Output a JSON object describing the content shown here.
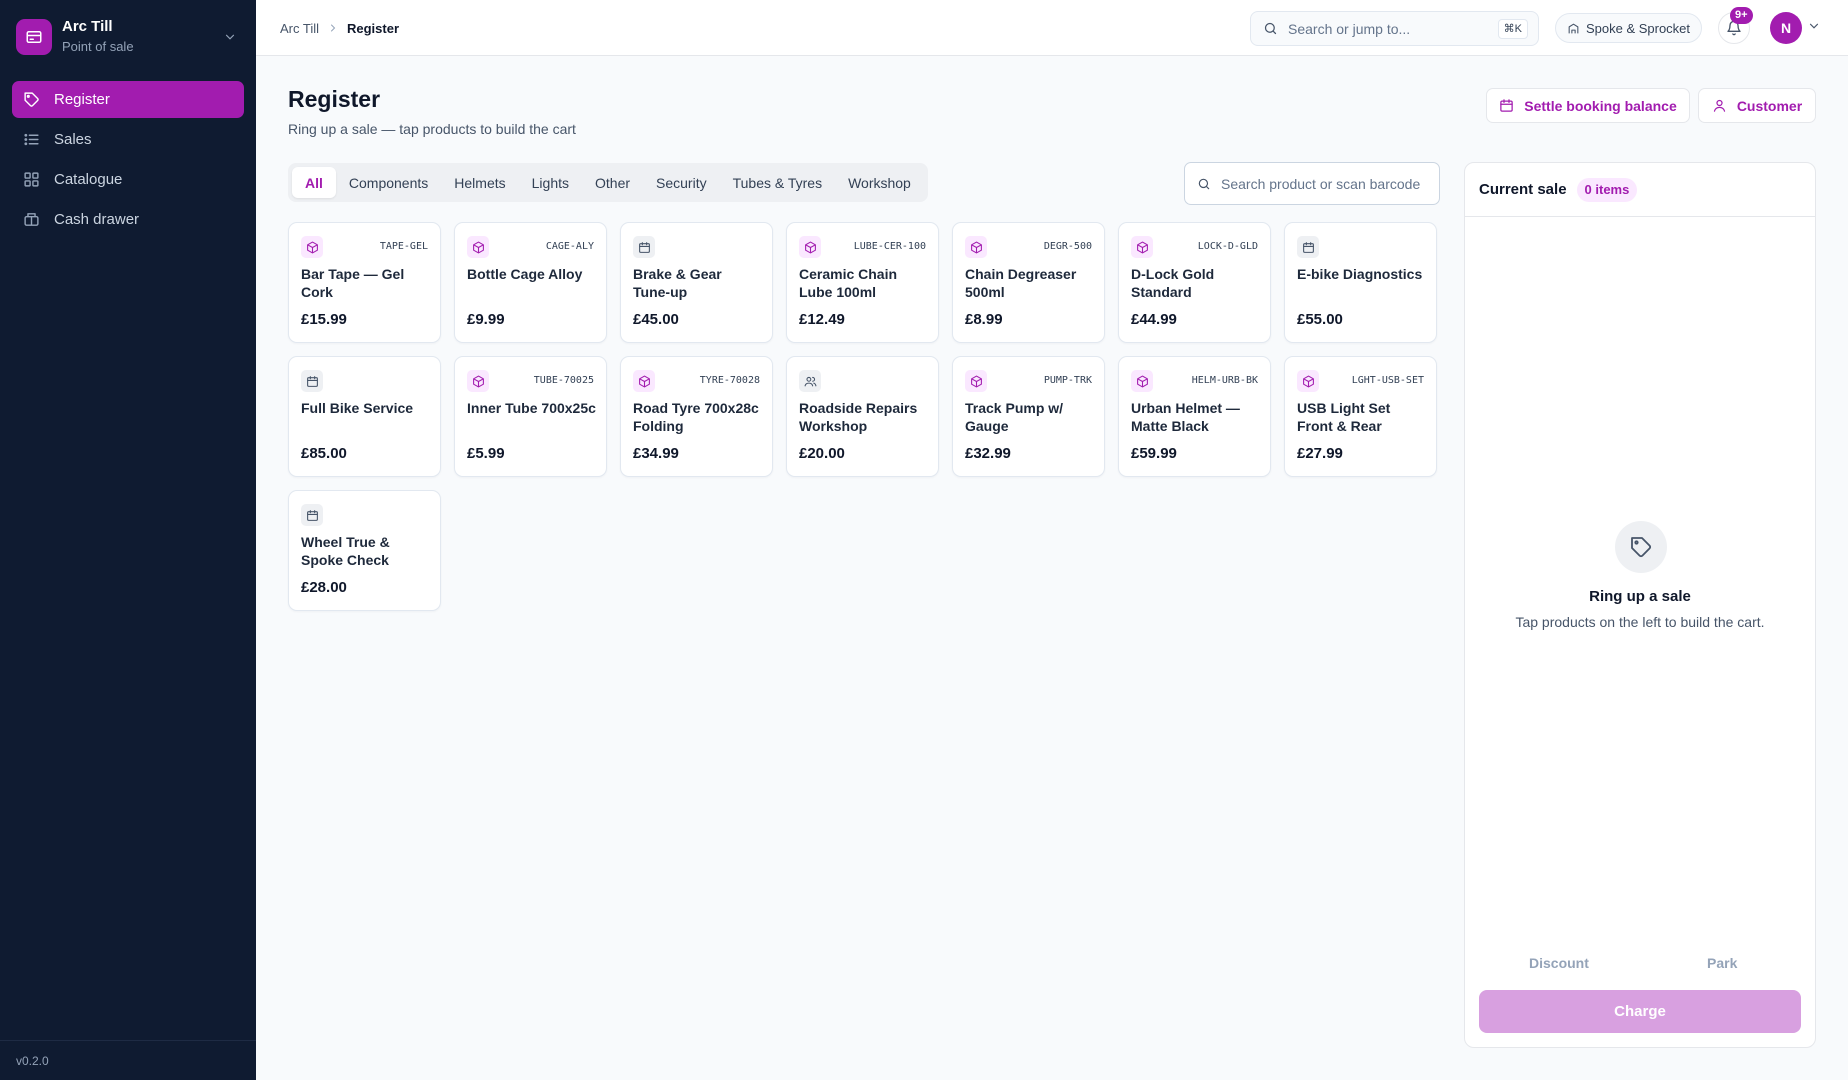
{
  "app": {
    "name": "Arc Till",
    "subtitle": "Point of sale",
    "version": "v0.2.0"
  },
  "sidebar": {
    "items": [
      {
        "label": "Register",
        "icon": "tag-icon",
        "active": true
      },
      {
        "label": "Sales",
        "icon": "list-icon",
        "active": false
      },
      {
        "label": "Catalogue",
        "icon": "grid-icon",
        "active": false
      },
      {
        "label": "Cash drawer",
        "icon": "cash-drawer-icon",
        "active": false
      }
    ]
  },
  "topbar": {
    "breadcrumb": [
      "Arc Till",
      "Register"
    ],
    "search_placeholder": "Search or jump to...",
    "search_shortcut": "⌘K",
    "store_name": "Spoke & Sprocket",
    "notification_badge": "9+",
    "avatar_initial": "N"
  },
  "page": {
    "title": "Register",
    "subtitle": "Ring up a sale — tap products to build the cart",
    "settle_label": "Settle booking balance",
    "customer_label": "Customer"
  },
  "tabs": [
    "All",
    "Components",
    "Helmets",
    "Lights",
    "Other",
    "Security",
    "Tubes & Tyres",
    "Workshop"
  ],
  "active_tab": "All",
  "product_search": {
    "placeholder": "Search product or scan barcode"
  },
  "products": [
    {
      "name": "Bar Tape — Gel Cork",
      "sku": "TAPE-GEL",
      "price": "£15.99",
      "kind": "product"
    },
    {
      "name": "Bottle Cage Alloy",
      "sku": "CAGE-ALY",
      "price": "£9.99",
      "kind": "product"
    },
    {
      "name": "Brake & Gear Tune-up",
      "sku": "",
      "price": "£45.00",
      "kind": "service"
    },
    {
      "name": "Ceramic Chain Lube 100ml",
      "sku": "LUBE-CER-100",
      "price": "£12.49",
      "kind": "product"
    },
    {
      "name": "Chain Degreaser 500ml",
      "sku": "DEGR-500",
      "price": "£8.99",
      "kind": "product"
    },
    {
      "name": "D-Lock Gold Standard",
      "sku": "LOCK-D-GLD",
      "price": "£44.99",
      "kind": "product"
    },
    {
      "name": "E-bike Diagnostics",
      "sku": "",
      "price": "£55.00",
      "kind": "service"
    },
    {
      "name": "Full Bike Service",
      "sku": "",
      "price": "£85.00",
      "kind": "service"
    },
    {
      "name": "Inner Tube 700x25c",
      "sku": "TUBE-70025",
      "price": "£5.99",
      "kind": "product"
    },
    {
      "name": "Road Tyre 700x28c Folding",
      "sku": "TYRE-70028",
      "price": "£34.99",
      "kind": "product"
    },
    {
      "name": "Roadside Repairs Workshop",
      "sku": "",
      "price": "£20.00",
      "kind": "event"
    },
    {
      "name": "Track Pump w/ Gauge",
      "sku": "PUMP-TRK",
      "price": "£32.99",
      "kind": "product"
    },
    {
      "name": "Urban Helmet — Matte Black",
      "sku": "HELM-URB-BK",
      "price": "£59.99",
      "kind": "product"
    },
    {
      "name": "USB Light Set Front & Rear",
      "sku": "LGHT-USB-SET",
      "price": "£27.99",
      "kind": "product"
    },
    {
      "name": "Wheel True & Spoke Check",
      "sku": "",
      "price": "£28.00",
      "kind": "service"
    }
  ],
  "cart": {
    "title": "Current sale",
    "count_label": "0 items",
    "empty_title": "Ring up a sale",
    "empty_subtitle": "Tap products on the left to build the cart.",
    "discount_label": "Discount",
    "park_label": "Park",
    "charge_label": "Charge"
  },
  "colors": {
    "accent": "#a21caf",
    "sidebar_bg": "#0f1b31",
    "accent_soft": "#fae8ff",
    "charge_disabled": "#d8a0e0"
  }
}
